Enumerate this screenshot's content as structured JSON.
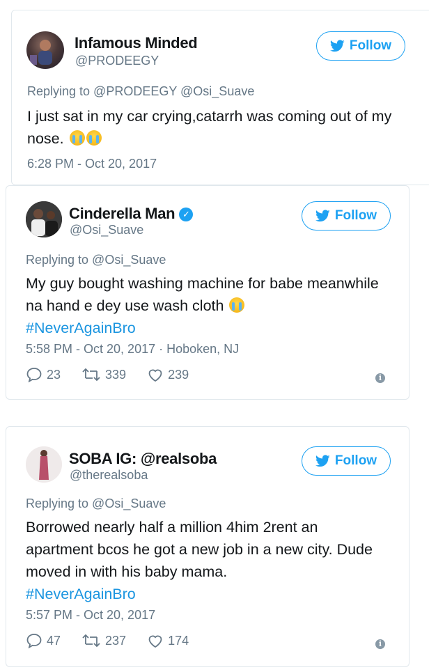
{
  "tweets": [
    {
      "name": "Infamous Minded",
      "handle": "@PRODEEGY",
      "verified": false,
      "follow_label": "Follow",
      "replying": "Replying to @PRODEEGY @Osi_Suave",
      "text": "I just sat in my car crying,catarrh was coming out of my nose.",
      "emoji": "loudly-crying-face",
      "hashtag": "",
      "timestamp": "6:28 PM - Oct 20, 2017"
    },
    {
      "name": "Cinderella Man",
      "handle": "@Osi_Suave",
      "verified": true,
      "follow_label": "Follow",
      "replying": "Replying to @Osi_Suave",
      "text": "My guy bought washing machine for babe meanwhile na hand e dey use wash cloth",
      "emoji": "tears-of-joy",
      "hashtag": "#NeverAgainBro",
      "timestamp": "5:58 PM - Oct 20, 2017 · Hoboken, NJ",
      "replies": "23",
      "retweets": "339",
      "likes": "239"
    },
    {
      "name": "SOBA IG: @realsoba",
      "handle": "@therealsoba",
      "verified": false,
      "follow_label": "Follow",
      "replying": "Replying to @Osi_Suave",
      "text": "Borrowed nearly half a million 4him 2rent an apartment bcos he got a new job in a new city. Dude moved in with his baby mama.",
      "hashtag": "#NeverAgainBro",
      "timestamp": "5:57 PM - Oct 20, 2017",
      "replies": "47",
      "retweets": "237",
      "likes": "174"
    }
  ],
  "colors": {
    "twitter_blue": "#1da1f2",
    "hashtag_blue": "#1b95e0",
    "secondary_text": "#657786",
    "border": "#e1e8ed"
  },
  "icons": [
    "twitter-bird-icon",
    "verified-badge-icon",
    "reply-icon",
    "retweet-icon",
    "heart-icon",
    "info-icon"
  ]
}
